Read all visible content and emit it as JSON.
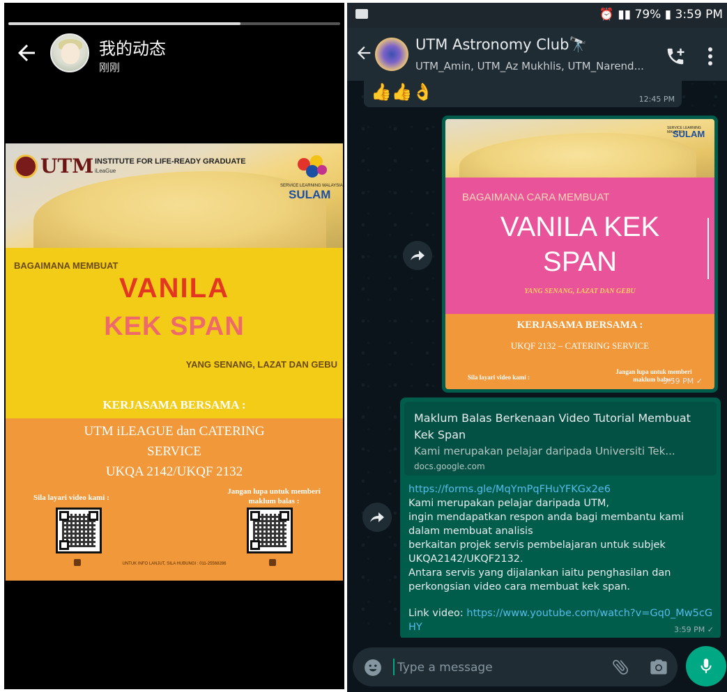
{
  "story": {
    "title": "我的动态",
    "time": "刚刚",
    "progress": 0.7,
    "poster": {
      "utm": "UTM",
      "institute": "INSTITUTE FOR LIFE-READY GRADUATE",
      "ileague": "iLeaGue",
      "sulam_small": "SERVICE LEARNING MALAYSIA",
      "sulam": "SULAM",
      "bagaimana": "BAGAIMANA MEMBUAT",
      "vanila": "VANILA",
      "kek_span": "KEK SPAN",
      "yang": "YANG SENANG, LAZAT DAN GEBU",
      "kerjasama": "KERJASAMA BERSAMA :",
      "collab_line1": "UTM iLEAGUE dan CATERING",
      "collab_line2": "SERVICE",
      "collab_line3": "UKQA 2142/UKQF 2132",
      "sila": "Sila layari video kami :",
      "jangan": "Jangan lupa untuk memberi maklum balas :",
      "footer": "UNTUK INFO LANJUT, SILA HUBUNGI : 011-25568286"
    }
  },
  "whatsapp": {
    "status": {
      "battery": "79%",
      "time": "3:59 PM"
    },
    "chat_title": "UTM Astronomy Club🔭",
    "chat_subtitle": "UTM_Amin, UTM_Az Mukhlis, UTM_Narend...",
    "messages": {
      "emoji_msg": {
        "text": "👍👍👌",
        "time": "12:45 PM"
      },
      "image_msg": {
        "sulam_small": "SERVICE LEARNING MALAYSIA",
        "sulam": "SULAM",
        "bagaimana": "BAGAIMANA CARA MEMBUAT",
        "title_line1": "VANILA KEK",
        "title_line2": "SPAN",
        "yang": "YANG SENANG, LAZAT DAN GEBU",
        "kerjasama": "KERJASAMA BERSAMA :",
        "ukq": "UKQF 2132 – CATERING SERVICE",
        "sila": "Sila layari video kami :",
        "jangan": "Jangan lupa untuk memberi maklum balas :",
        "time": "3:59 PM"
      },
      "link_msg": {
        "preview_title": "Maklum Balas Berkenaan Video Tutorial Membuat Kek Span",
        "preview_desc": "Kami merupakan pelajar daripada Universiti Tek...",
        "preview_domain": "docs.google.com",
        "link": "https://forms.gle/MqYmPqFHuYFKGx2e6",
        "body_lines": [
          "Kami merupakan pelajar daripada UTM,",
          "ingin mendapatkan respon anda bagi membantu kami dalam membuat analisis",
          "berkaitan projek servis pembelajaran untuk subjek UKQA2142/UKQF2132.",
          "Antara servis yang dijalankan iaitu penghasilan dan perkongsian video cara membuat kek span."
        ],
        "video_label": "Link video: ",
        "video_link": "https://www.youtube.com/watch?v=Gq0_Mw5cGHY",
        "time": "3:59 PM"
      }
    },
    "input": {
      "placeholder": "Type a message"
    },
    "colors": {
      "accent": "#00a884",
      "outgoing": "#005c4b",
      "link": "#53bdeb"
    }
  }
}
